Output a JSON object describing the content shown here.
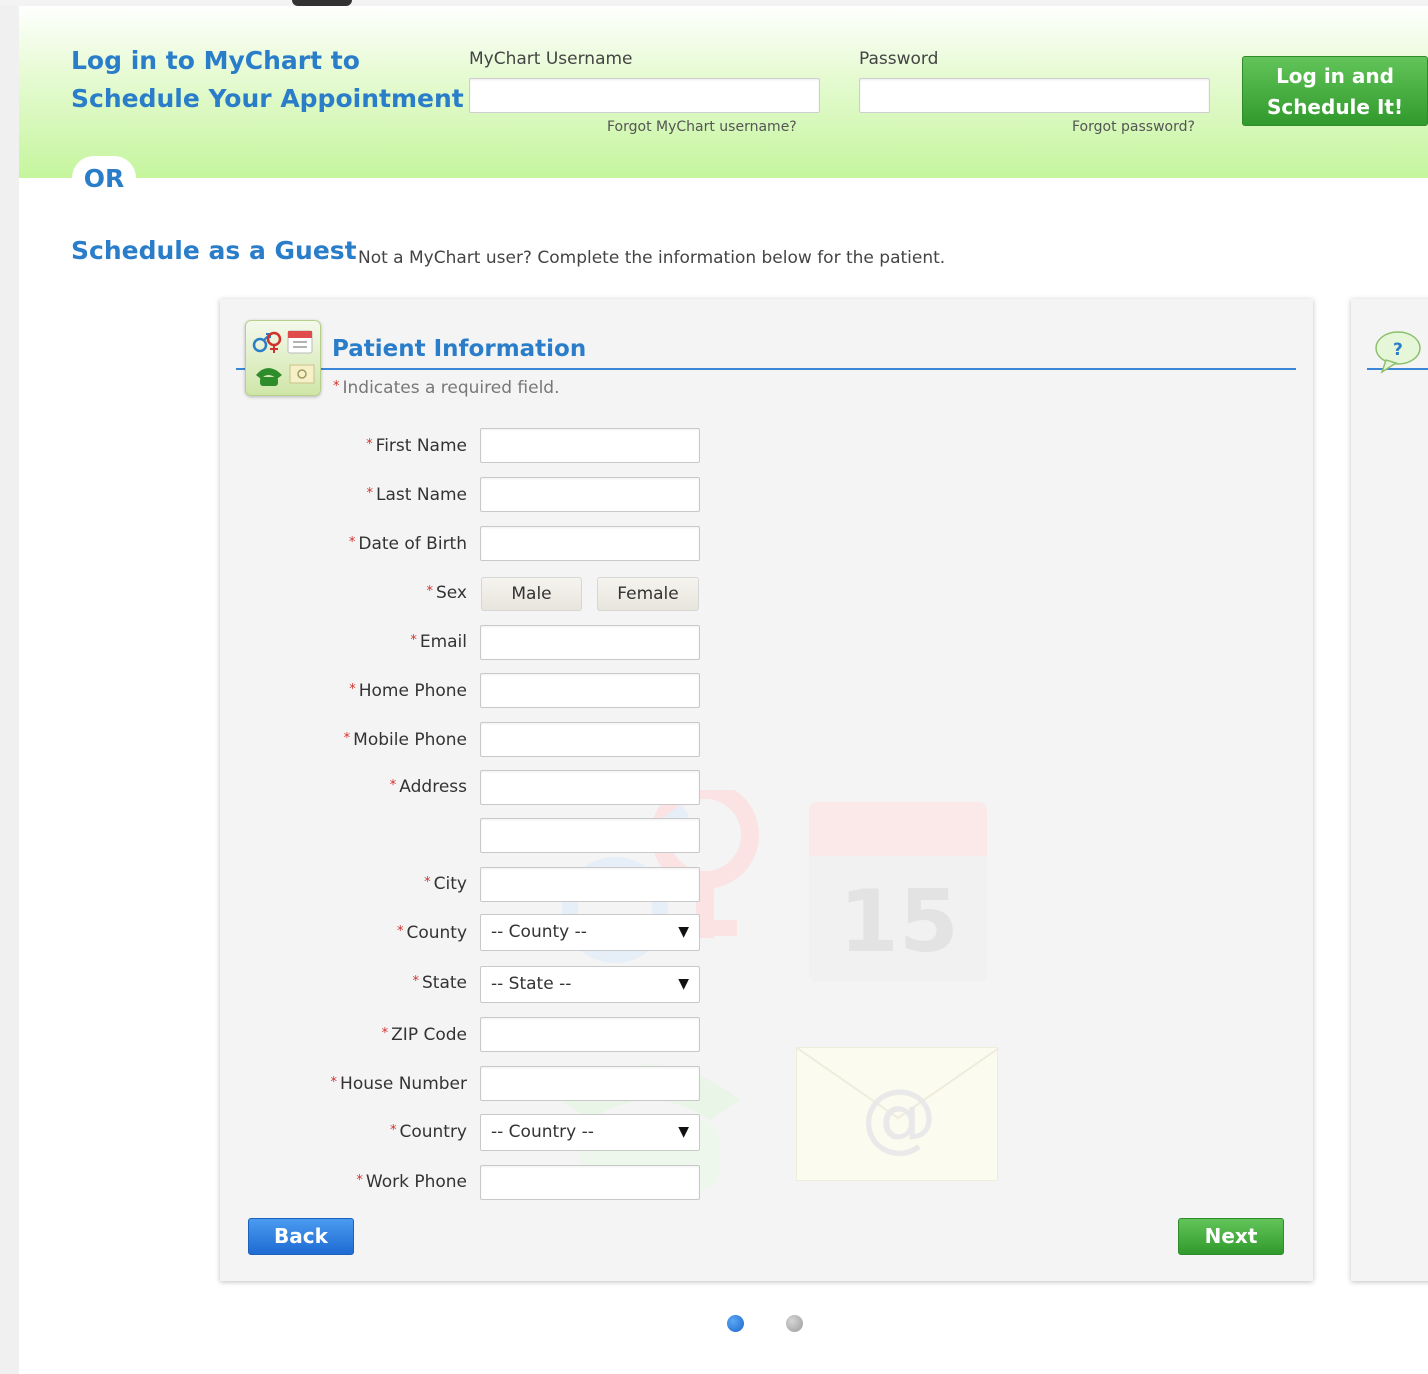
{
  "login": {
    "title_line1": "Log in to MyChart to",
    "title_line2": "Schedule Your Appointment",
    "username_label": "MyChart Username",
    "password_label": "Password",
    "forgot_username": "Forgot MyChart username?",
    "forgot_password": "Forgot password?",
    "submit_line1": "Log in and",
    "submit_line2": "Schedule It!"
  },
  "or_label": "OR",
  "guest": {
    "title": "Schedule as a Guest",
    "subtitle": "Not a MyChart user? Complete the information below for the patient."
  },
  "patient_info": {
    "title": "Patient Information",
    "required_note": "Indicates a required field.",
    "fields": {
      "first_name": "First Name",
      "last_name": "Last Name",
      "dob": "Date of Birth",
      "sex": "Sex",
      "email": "Email",
      "home_phone": "Home Phone",
      "mobile_phone": "Mobile Phone",
      "address": "Address",
      "city": "City",
      "county": "County",
      "state": "State",
      "zip": "ZIP Code",
      "house_number": "House Number",
      "country": "Country",
      "work_phone": "Work Phone"
    },
    "sex_options": {
      "male": "Male",
      "female": "Female"
    },
    "county_selected": "-- County --",
    "state_selected": "-- State --",
    "country_selected": "-- Country --",
    "back_label": "Back",
    "next_label": "Next"
  },
  "watermark": {
    "calendar_day": "15",
    "email_symbol": "@"
  },
  "colors": {
    "brand_blue": "#2a7dc9",
    "green": "#319a2c",
    "required": "#d0312d"
  },
  "pager": {
    "active": 1,
    "total": 2
  }
}
